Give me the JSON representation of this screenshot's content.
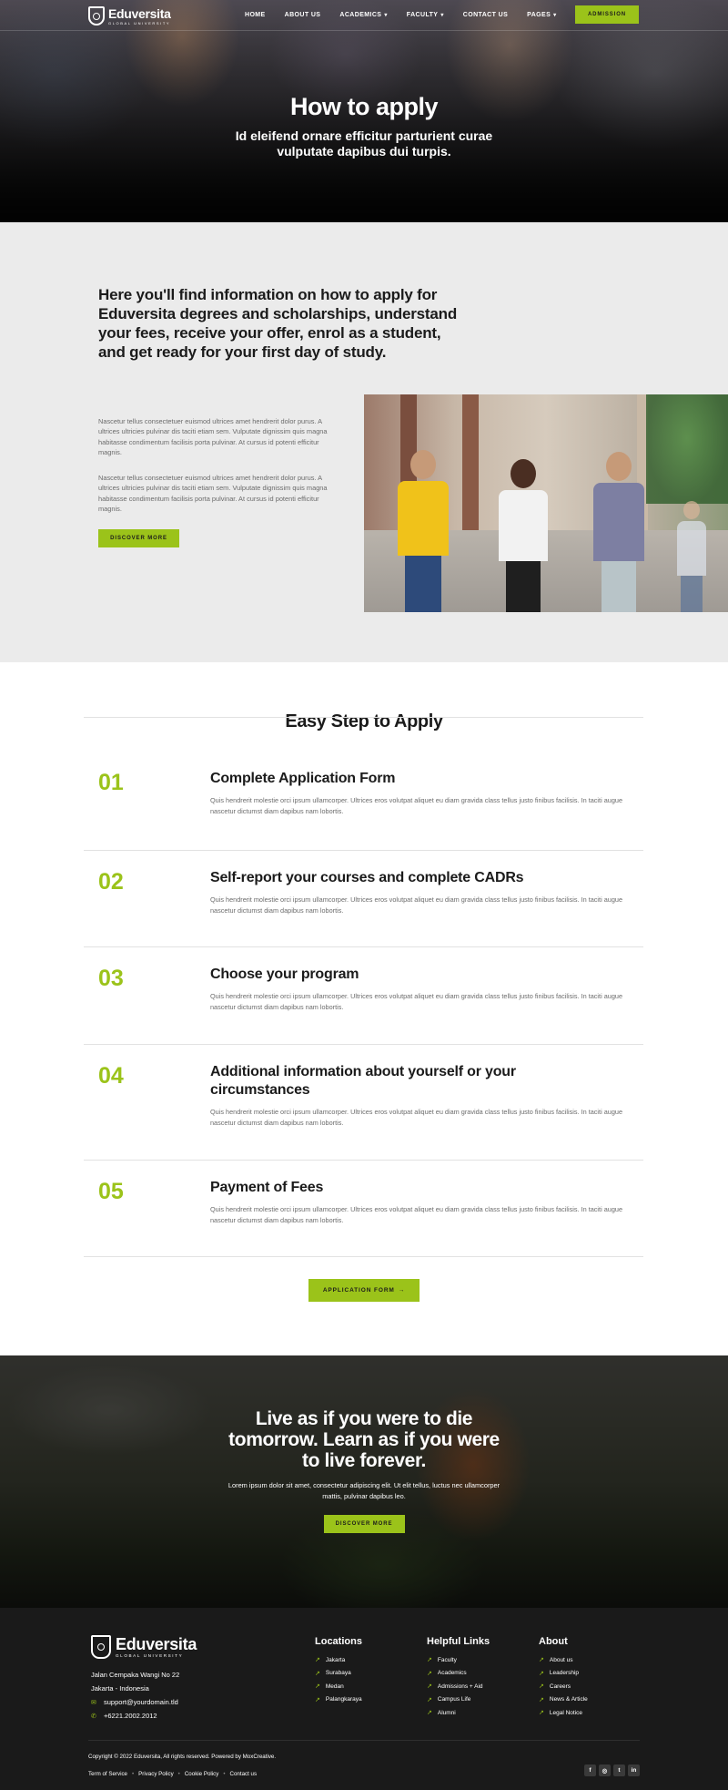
{
  "brand": {
    "name": "Eduversita",
    "tagline": "GLOBAL UNIVERSITY"
  },
  "nav": {
    "items": [
      {
        "label": "HOME",
        "dropdown": false
      },
      {
        "label": "ABOUT US",
        "dropdown": false
      },
      {
        "label": "ACADEMICS",
        "dropdown": true
      },
      {
        "label": "FACULTY",
        "dropdown": true
      },
      {
        "label": "CONTACT US",
        "dropdown": false
      },
      {
        "label": "PAGES",
        "dropdown": true
      }
    ],
    "cta": "ADMISSION"
  },
  "hero": {
    "title": "How to apply",
    "subtitle": "Id eleifend ornare efficitur parturient curae vulputate dapibus dui turpis."
  },
  "intro": {
    "heading": "Here you'll find information on how to apply for Eduversita degrees and scholarships, understand your fees, receive your offer, enrol as a student, and get ready for your first day of study.",
    "paragraphs": [
      "Nascetur tellus consectetuer euismod ultrices amet hendrerit dolor purus. A ultrices ultricies pulvinar dis taciti etiam sem. Vulputate dignissim quis magna habitasse condimentum facilisis porta pulvinar. At cursus id potenti efficitur magnis.",
      "Nascetur tellus consectetuer euismod ultrices amet hendrerit dolor purus. A ultrices ultricies pulvinar dis taciti etiam sem. Vulputate dignissim quis magna habitasse condimentum facilisis porta pulvinar. At cursus id potenti efficitur magnis."
    ],
    "button": "DISCOVER MORE"
  },
  "steps": {
    "title": "Easy Step to Apply",
    "items": [
      {
        "num": "01",
        "title": "Complete Application Form",
        "desc": "Quis hendrerit molestie orci ipsum ullamcorper. Ultrices eros volutpat aliquet eu diam gravida class tellus justo finibus facilisis. In taciti augue nascetur dictumst diam dapibus nam lobortis."
      },
      {
        "num": "02",
        "title": "Self-report your courses and complete CADRs",
        "desc": "Quis hendrerit molestie orci ipsum ullamcorper. Ultrices eros volutpat aliquet eu diam gravida class tellus justo finibus facilisis. In taciti augue nascetur dictumst diam dapibus nam lobortis."
      },
      {
        "num": "03",
        "title": "Choose your program",
        "desc": "Quis hendrerit molestie orci ipsum ullamcorper. Ultrices eros volutpat aliquet eu diam gravida class tellus justo finibus facilisis. In taciti augue nascetur dictumst diam dapibus nam lobortis."
      },
      {
        "num": "04",
        "title": "Additional information about yourself or your circumstances",
        "desc": "Quis hendrerit molestie orci ipsum ullamcorper. Ultrices eros volutpat aliquet eu diam gravida class tellus justo finibus facilisis. In taciti augue nascetur dictumst diam dapibus nam lobortis."
      },
      {
        "num": "05",
        "title": "Payment of Fees",
        "desc": "Quis hendrerit molestie orci ipsum ullamcorper. Ultrices eros volutpat aliquet eu diam gravida class tellus justo finibus facilisis. In taciti augue nascetur dictumst diam dapibus nam lobortis."
      }
    ],
    "button": "APPLICATION FORM",
    "button_icon": "→"
  },
  "quote": {
    "title": "Live as if you were to die tomorrow. Learn as if you were to live forever.",
    "text": "Lorem ipsum dolor sit amet, consectetur adipiscing elit. Ut elit tellus, luctus nec ullamcorper mattis, pulvinar dapibus leo.",
    "button": "DISCOVER MORE"
  },
  "footer": {
    "address_line1": "Jalan Cempaka Wangi No 22",
    "address_line2": "Jakarta - Indonesia",
    "email": "support@yourdomain.tld",
    "phone": "+6221.2002.2012",
    "columns": [
      {
        "title": "Locations",
        "links": [
          "Jakarta",
          "Surabaya",
          "Medan",
          "Palangkaraya"
        ]
      },
      {
        "title": "Helpful Links",
        "links": [
          "Faculty",
          "Academics",
          "Admissions + Aid",
          "Campus Life",
          "Alumni"
        ]
      },
      {
        "title": "About",
        "links": [
          "About us",
          "Leadership",
          "Careers",
          "News & Article",
          "Legal Notice"
        ]
      }
    ],
    "copyright": "Copyright © 2022 Eduversita, All rights reserved. Powered by MoxCreative.",
    "legal": [
      "Term of Service",
      "Privacy Policy",
      "Cookie Policy",
      "Contact us"
    ],
    "socials": [
      "facebook-icon",
      "instagram-icon",
      "twitter-icon",
      "linkedin-icon"
    ]
  },
  "colors": {
    "accent": "#9bc31a",
    "dark": "#1a1a1a",
    "light_bg": "#ebebeb"
  }
}
